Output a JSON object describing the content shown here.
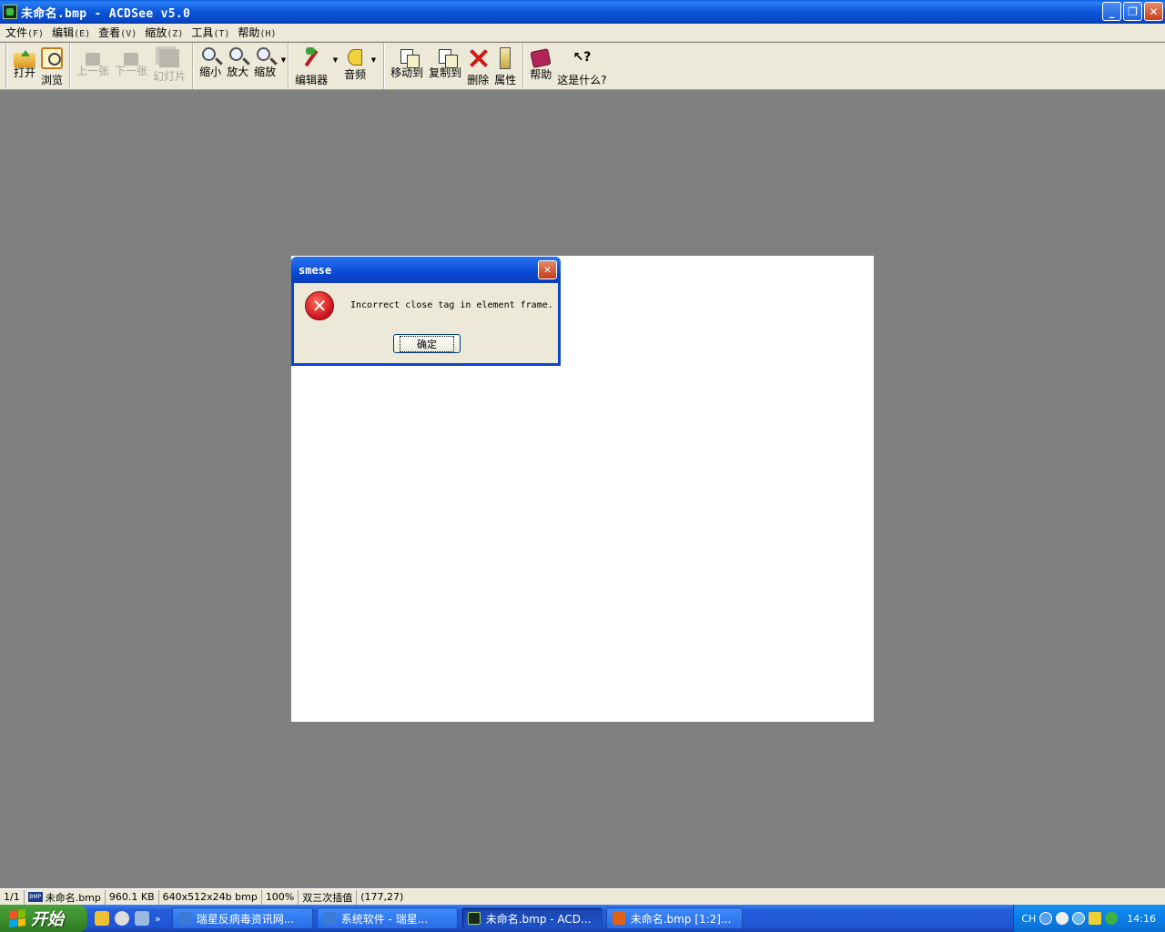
{
  "window": {
    "title": "未命名.bmp - ACDSee v5.0",
    "minimize": "_",
    "restore": "❐",
    "close": "✕"
  },
  "menu": [
    {
      "label": "文件",
      "accel": "(F)"
    },
    {
      "label": "编辑",
      "accel": "(E)"
    },
    {
      "label": "查看",
      "accel": "(V)"
    },
    {
      "label": "缩放",
      "accel": "(Z)"
    },
    {
      "label": "工具",
      "accel": "(T)"
    },
    {
      "label": "帮助",
      "accel": "(H)"
    }
  ],
  "toolbar": {
    "open": "打开",
    "browse": "浏览",
    "prev": "上一张",
    "next": "下一张",
    "slideshow": "幻灯片",
    "zoom_out": "缩小",
    "zoom_in": "放大",
    "zoom": "缩放",
    "editor": "编辑器",
    "audio": "音频",
    "move_to": "移动到",
    "copy_to": "复制到",
    "delete": "删除",
    "properties": "属性",
    "help": "帮助",
    "whats_this": "这是什么?",
    "whats_this_glyph": "↖?"
  },
  "dialog": {
    "title": "smese",
    "close_glyph": "✕",
    "error_glyph": "✕",
    "message": "Incorrect close tag in element frame.",
    "ok_label": "确定"
  },
  "status": {
    "index": "1/1",
    "file_icon_text": "BMP",
    "filename": "未命名.bmp",
    "filesize": "960.1 KB",
    "dimensions": "640x512x24b bmp",
    "zoom": "100%",
    "interpolation": "双三次插值",
    "cursor": "(177,27)"
  },
  "taskbar": {
    "start_label": "开始",
    "more": "»",
    "tasks": [
      {
        "label": "瑞星反病毒资讯网...",
        "icon_color": "#3a7bd5"
      },
      {
        "label": "系统软件 - 瑞星...",
        "icon_color": "#3a7bd5"
      },
      {
        "label": "未命名.bmp - ACD...",
        "icon_color": "#1b2b1b"
      },
      {
        "label": "未命名.bmp [1:2]...",
        "icon_color": "#e0601a"
      }
    ],
    "tray": {
      "lang": "CH",
      "time": "14:16"
    }
  },
  "colors": {
    "titlebar": "#0b54d8",
    "workspace": "#808080",
    "error_red": "#c8101a",
    "start_green": "#3c8f2e"
  }
}
